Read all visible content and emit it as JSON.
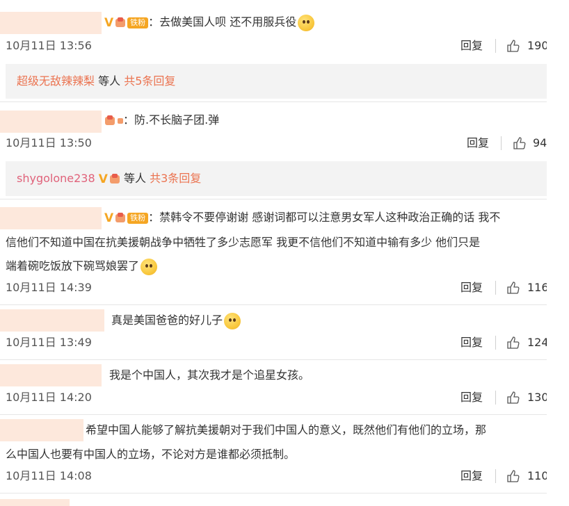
{
  "comments": [
    {
      "text": "：去做美国人呗 还不用服兵役",
      "time": "10月11日 13:56",
      "reply_label": "回复",
      "likes": "190",
      "replies": {
        "user": "超级无敌辣辣梨",
        "suffix": " 等人 ",
        "count_text": "共5条回复"
      }
    },
    {
      "text": "：防.不长脑子团.弹",
      "time": "10月11日 13:50",
      "reply_label": "回复",
      "likes": "94",
      "replies": {
        "user": "shygolone238",
        "suffix": " 等人 ",
        "count_text": "共3条回复"
      }
    },
    {
      "lines": [
        "：禁韩令不要停谢谢 感谢词都可以注意男女军人这种政治正确的话 我不",
        "信他们不知道中国在抗美援朝战争中牺牲了多少志愿军 我更不信他们不知道中输有多少  他们只是",
        "端着碗吃饭放下碗骂娘罢了"
      ],
      "time": "10月11日 14:39",
      "reply_label": "回复",
      "likes": "116"
    },
    {
      "text": "真是美国爸爸的好儿子",
      "time": "10月11日 13:49",
      "reply_label": "回复",
      "likes": "124"
    },
    {
      "text": "我是个中国人，其次我才是个追星女孩。",
      "time": "10月11日 14:20",
      "reply_label": "回复",
      "likes": "130"
    },
    {
      "lines": [
        "希望中国人能够了解抗美援朝对于我们中国人的意义，既然他们有他们的立场，那",
        "么中国人也要有中国人的立场，不论对方是谁都必须抵制。"
      ],
      "time": "10月11日 14:08",
      "reply_label": "回复",
      "likes": "110"
    }
  ],
  "badges": {
    "verified": "V",
    "fan_tag": "铁粉"
  },
  "colors": {
    "link_orange": "#eb7350",
    "name_mask": "#fde8dc",
    "reply_bg": "#f3f3f3",
    "user_pink": "#e0627a"
  },
  "icons": {
    "like": "thumbs-up-icon",
    "emoji": "smile-emoji-icon",
    "crown": "crown-badge-icon"
  }
}
